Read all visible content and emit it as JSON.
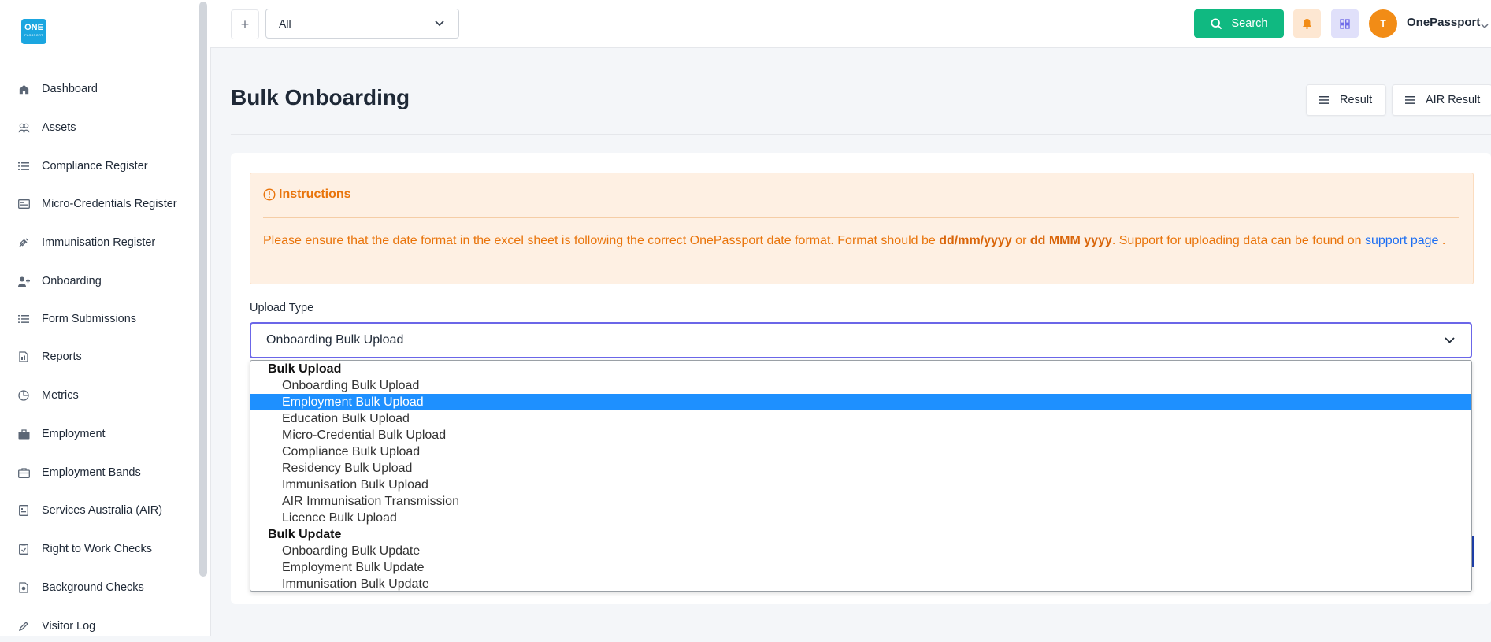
{
  "app": {
    "logo_line1": "ONE",
    "logo_line2": "PASSPORT"
  },
  "sidebar": {
    "items": [
      {
        "label": "Dashboard",
        "icon": "home-icon"
      },
      {
        "label": "Assets",
        "icon": "users-icon"
      },
      {
        "label": "Compliance Register",
        "icon": "list-icon"
      },
      {
        "label": "Micro-Credentials Register",
        "icon": "id-card-icon"
      },
      {
        "label": "Immunisation Register",
        "icon": "syringe-icon"
      },
      {
        "label": "Onboarding",
        "icon": "user-add-icon"
      },
      {
        "label": "Form Submissions",
        "icon": "list-icon"
      },
      {
        "label": "Reports",
        "icon": "document-icon"
      },
      {
        "label": "Metrics",
        "icon": "pie-chart-icon"
      },
      {
        "label": "Employment",
        "icon": "briefcase-icon"
      },
      {
        "label": "Employment Bands",
        "icon": "briefcase-outline-icon"
      },
      {
        "label": "Services Australia (AIR)",
        "icon": "file-icon"
      },
      {
        "label": "Right to Work Checks",
        "icon": "clipboard-check-icon"
      },
      {
        "label": "Background Checks",
        "icon": "shield-document-icon"
      },
      {
        "label": "Visitor Log",
        "icon": "pen-icon"
      }
    ]
  },
  "header": {
    "scope_value": "All",
    "search_label": "Search",
    "user_initial": "T",
    "user_name": "OnePassport"
  },
  "page": {
    "title": "Bulk Onboarding",
    "result_label": "Result",
    "air_result_label": "AIR Result"
  },
  "instructions": {
    "title": "Instructions",
    "text_1": "Please ensure that the date format in the excel sheet is following the correct OnePassport date format. Format should be ",
    "format_1": "dd/mm/yyyy",
    "text_or": " or ",
    "format_2": "dd MMM yyyy",
    "text_2": ". Support for uploading data can be found on ",
    "link": "support page",
    "text_3": " ."
  },
  "upload": {
    "label": "Upload Type",
    "selected": "Onboarding Bulk Upload",
    "groups": [
      {
        "label": "Bulk Upload",
        "options": [
          "Onboarding Bulk Upload",
          "Employment Bulk Upload",
          "Education Bulk Upload",
          "Micro-Credential Bulk Upload",
          "Compliance Bulk Upload",
          "Residency Bulk Upload",
          "Immunisation Bulk Upload",
          "AIR Immunisation Transmission",
          "Licence Bulk Upload"
        ]
      },
      {
        "label": "Bulk Update",
        "options": [
          "Onboarding Bulk Update",
          "Employment Bulk Update",
          "Immunisation Bulk Update"
        ]
      }
    ],
    "highlighted": "Employment Bulk Upload"
  },
  "colors": {
    "accent": "#10b981",
    "warning": "#e9740b",
    "highlight": "#1e90ff",
    "focus": "#6b66e8"
  }
}
